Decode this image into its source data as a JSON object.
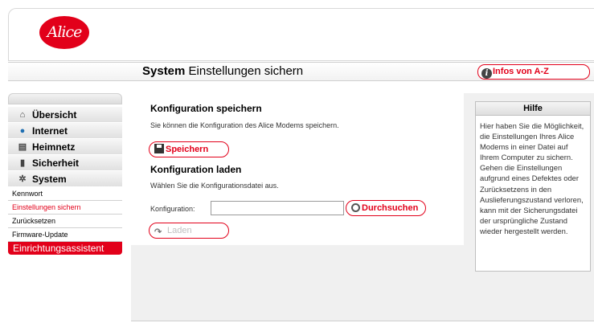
{
  "header": {
    "logo_text": "Alice",
    "title_bold": "System",
    "title_rest": " Einstellungen sichern",
    "info_button": "Infos von A-Z"
  },
  "sidebar": {
    "items": [
      {
        "label": "Übersicht",
        "icon": "house-icon"
      },
      {
        "label": "Internet",
        "icon": "globe-icon"
      },
      {
        "label": "Heimnetz",
        "icon": "network-icon"
      },
      {
        "label": "Sicherheit",
        "icon": "lock-icon"
      },
      {
        "label": "System",
        "icon": "gear-icon"
      }
    ],
    "sub_items": [
      {
        "label": "Kennwort",
        "active": false
      },
      {
        "label": "Einstellungen sichern",
        "active": true
      },
      {
        "label": "Zurücksetzen",
        "active": false
      },
      {
        "label": "Firmware-Update",
        "active": false
      }
    ],
    "wizard": "Einrichtungsassistent"
  },
  "main": {
    "save_section": {
      "title": "Konfiguration speichern",
      "text": "Sie können die Konfiguration des Alice Modems speichern.",
      "button": "Speichern"
    },
    "load_section": {
      "title": "Konfiguration laden",
      "text": "Wählen Sie die Konfigurationsdatei aus.",
      "field_label": "Konfiguration:",
      "field_value": "",
      "browse_button": "Durchsuchen",
      "load_button": "Laden"
    }
  },
  "help": {
    "title": "Hilfe",
    "text": "Hier haben Sie die Möglichkeit, die Einstellungen Ihres Alice Modems in einer Datei auf Ihrem Computer zu sichern. Gehen die Einstellungen aufgrund eines Defektes oder Zurücksetzens in den Auslieferungszustand verloren, kann mit der Sicherungsdatei der ursprüngliche Zustand wieder hergestellt werden."
  },
  "colors": {
    "brand_red": "#e2001a"
  }
}
